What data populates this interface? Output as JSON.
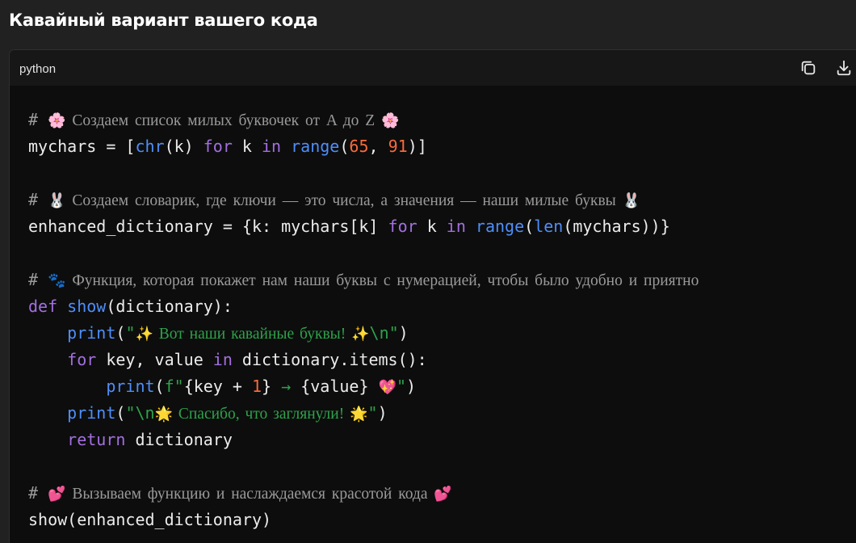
{
  "page": {
    "heading": "Кавайный вариант вашего кода"
  },
  "code_block": {
    "language": "python",
    "buttons": {
      "copy_icon": "copy-icon",
      "download_icon": "download-icon"
    }
  },
  "code": {
    "l1": {
      "hash": "# ",
      "e1": "🌸",
      "text": " Создаем список милых буквочек от A до Z ",
      "e2": "🌸"
    },
    "l2": {
      "a": "mychars = [",
      "b": "chr",
      "c": "(k) ",
      "d": "for",
      "e": " k ",
      "f": "in",
      "g": " ",
      "h": "range",
      "i": "(",
      "j": "65",
      "k": ", ",
      "l": "91",
      "m": ")]"
    },
    "l4": {
      "hash": "# ",
      "e1": "🐰",
      "text": " Создаем словарик, где ключи — это числа, а значения — наши милые буквы ",
      "e2": "🐰"
    },
    "l5": {
      "a": "enhanced_dictionary = {k: mychars[k] ",
      "b": "for",
      "c": " k ",
      "d": "in",
      "e": " ",
      "f": "range",
      "g": "(",
      "h": "len",
      "i": "(mychars))}"
    },
    "l7": {
      "hash": "# ",
      "e1": "🐾",
      "text": " Функция, которая покажет нам наши буквы с нумерацией, чтобы было удобно и приятно"
    },
    "l8": {
      "a": "def",
      "b": " ",
      "c": "show",
      "d": "(dictionary):"
    },
    "l9": {
      "indent": "    ",
      "a": "print",
      "b": "(",
      "c": "\"",
      "e1": "✨",
      "d": " Вот наши кавайные буквы! ",
      "e2": "✨",
      "f": "\\n\"",
      "g": ")"
    },
    "l10": {
      "indent": "    ",
      "a": "for",
      "b": " key, value ",
      "c": "in",
      "d": " dictionary.items():"
    },
    "l11": {
      "indent": "        ",
      "a": "print",
      "b": "(",
      "c": "f\"",
      "d": "{key + ",
      "e": "1",
      "f": "} ",
      "g": "→",
      "h": " {value} ",
      "e1": "💖",
      "i": "\"",
      "j": ")"
    },
    "l12": {
      "indent": "    ",
      "a": "print",
      "b": "(",
      "c": "\"\\n",
      "e1": "🌟",
      "d": " Спасибо, что заглянули! ",
      "e2": "🌟",
      "f": "\"",
      "g": ")"
    },
    "l13": {
      "indent": "    ",
      "a": "return",
      "b": " dictionary"
    },
    "l15": {
      "hash": "# ",
      "e1": "💕",
      "text": " Вызываем функцию и наслаждаемся красотой кода ",
      "e2": "💕"
    },
    "l16": {
      "a": "show(enhanced_dictionary)"
    }
  },
  "colors": {
    "background": "#212121",
    "code_background": "#0d0d0d",
    "header_background": "#171717",
    "keyword": "#a26fe0",
    "function": "#4f8ef7",
    "number": "#f76a3c",
    "string": "#2ea24b",
    "comment": "#9a9a9a"
  }
}
